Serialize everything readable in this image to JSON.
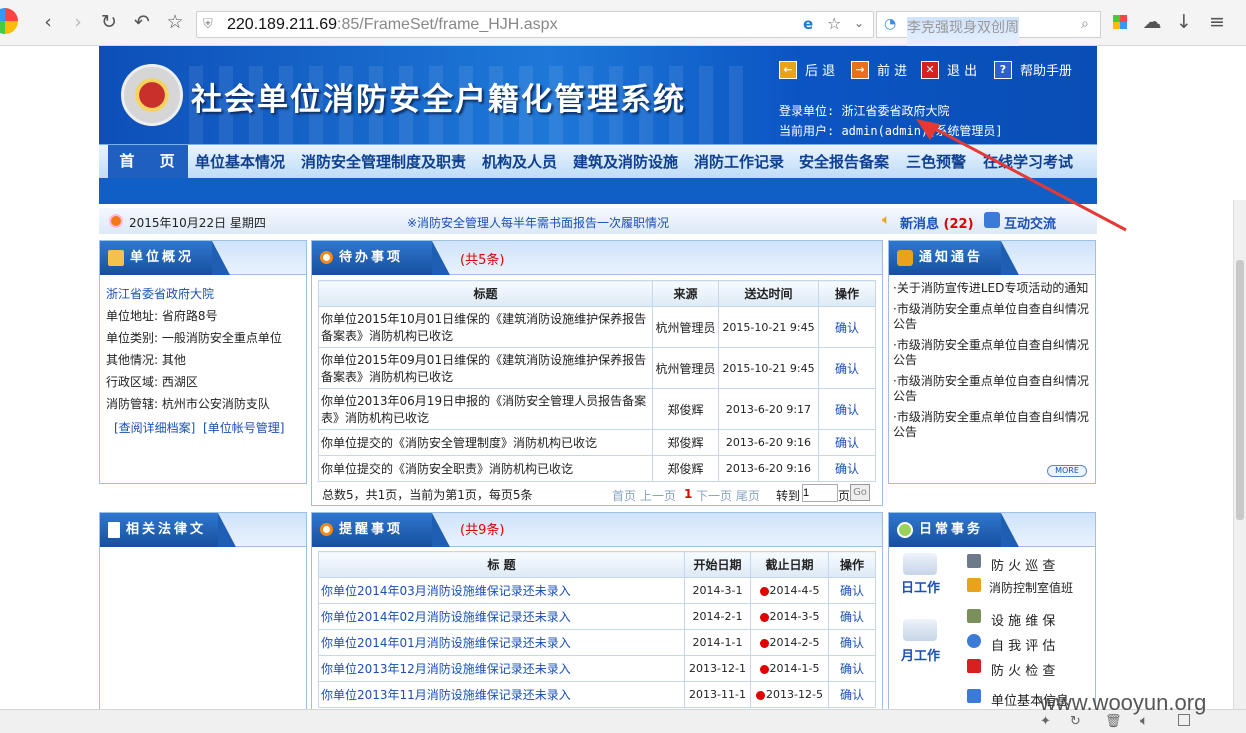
{
  "browser": {
    "url_host": "220.189.211.69",
    "url_port": ":85",
    "url_path": "/FrameSet/frame_HJH.aspx",
    "search_placeholder": "李克强现身双创周",
    "watermark": "www.wooyun.org"
  },
  "header": {
    "system_title": "社会单位消防安全户籍化管理系统",
    "toolbar": [
      {
        "icon": "back-icon",
        "label": "后 退"
      },
      {
        "icon": "forward-icon",
        "label": "前 进"
      },
      {
        "icon": "exit-icon",
        "label": "退 出"
      },
      {
        "icon": "help-icon",
        "label": "帮助手册"
      }
    ],
    "login_unit": "登录单位: 浙江省委省政府大院",
    "current_user": "当前用户: admin(admin)[系统管理员]"
  },
  "menu": {
    "home": "首 页",
    "items": [
      "单位基本情况",
      "消防安全管理制度及职责",
      "机构及人员",
      "建筑及消防设施",
      "消防工作记录",
      "安全报告备案",
      "三色预警",
      "在线学习考试"
    ]
  },
  "infobar": {
    "date": "2015年10月22日  星期四",
    "notice": "※消防安全管理人每半年需书面报告一次履职情况",
    "new_msg": "新消息",
    "new_msg_count": "(22)",
    "interact": "互动交流"
  },
  "overview": {
    "title": "单位概况",
    "name": "浙江省委省政府大院",
    "rows": [
      "单位地址: 省府路8号",
      "单位类别: 一般消防安全重点单位",
      "其他情况: 其他",
      "行政区域: 西湖区",
      "消防管辖: 杭州市公安消防支队"
    ],
    "link1": "[查阅详细档案]",
    "link2": "[单位帐号管理]"
  },
  "todo": {
    "title": "待办事项",
    "count": "(共5条)",
    "headers": [
      "标题",
      "来源",
      "送达时间",
      "操作"
    ],
    "rows": [
      [
        "你单位2015年10月01日维保的《建筑消防设施维护保养报告备案表》消防机构已收讫",
        "杭州管理员",
        "2015-10-21  9:45",
        "确认"
      ],
      [
        "你单位2015年09月01日维保的《建筑消防设施维护保养报告备案表》消防机构已收讫",
        "杭州管理员",
        "2015-10-21  9:45",
        "确认"
      ],
      [
        "你单位2013年06月19日申报的《消防安全管理人员报告备案表》消防机构已收讫",
        "郑俊辉",
        "2013-6-20  9:17",
        "确认"
      ],
      [
        "你单位提交的《消防安全管理制度》消防机构已收讫",
        "郑俊辉",
        "2013-6-20  9:16",
        "确认"
      ],
      [
        "你单位提交的《消防安全职责》消防机构已收讫",
        "郑俊辉",
        "2013-6-20  9:16",
        "确认"
      ]
    ],
    "pager_info": "总数5，共1页，当前为第1页，每页5条",
    "pager_links": "首页 上一页",
    "pager_current": "1",
    "pager_links2": "下一页 尾页",
    "goto_label": "转到",
    "goto_value": "1",
    "page_label": "页",
    "go": "Go"
  },
  "notices": {
    "title": "通知通告",
    "items": [
      "·关于消防宣传进LED专项活动的通知",
      "·市级消防安全重点单位自查自纠情况公告",
      "·市级消防安全重点单位自查自纠情况公告",
      "·市级消防安全重点单位自查自纠情况公告",
      "·市级消防安全重点单位自查自纠情况公告"
    ],
    "more": "MORE"
  },
  "laws": {
    "title": "相关法律文书"
  },
  "reminders": {
    "title": "提醒事项",
    "count": "(共9条)",
    "headers": [
      "标 题",
      "开始日期",
      "截止日期",
      "操作"
    ],
    "rows": [
      [
        "你单位2014年03月消防设施维保记录还未录入",
        "2014-3-1",
        "2014-4-5",
        "确认"
      ],
      [
        "你单位2014年02月消防设施维保记录还未录入",
        "2014-2-1",
        "2014-3-5",
        "确认"
      ],
      [
        "你单位2014年01月消防设施维保记录还未录入",
        "2014-1-1",
        "2014-2-5",
        "确认"
      ],
      [
        "你单位2013年12月消防设施维保记录还未录入",
        "2013-12-1",
        "2014-1-5",
        "确认"
      ],
      [
        "你单位2013年11月消防设施维保记录还未录入",
        "2013-11-1",
        "2013-12-5",
        "确认"
      ]
    ]
  },
  "daily": {
    "title": "日常事务",
    "day_label": "日工作",
    "month_label": "月工作",
    "day_items": [
      "防 火 巡 查",
      "消防控制室值班"
    ],
    "month_items": [
      "设 施 维 保",
      "自 我 评 估",
      "防 火 检 查"
    ],
    "extra": "单位基本信息"
  },
  "colors": {
    "accent": "#1a4fb8",
    "warning": "#e00000",
    "banner": "#0d4fb8"
  }
}
